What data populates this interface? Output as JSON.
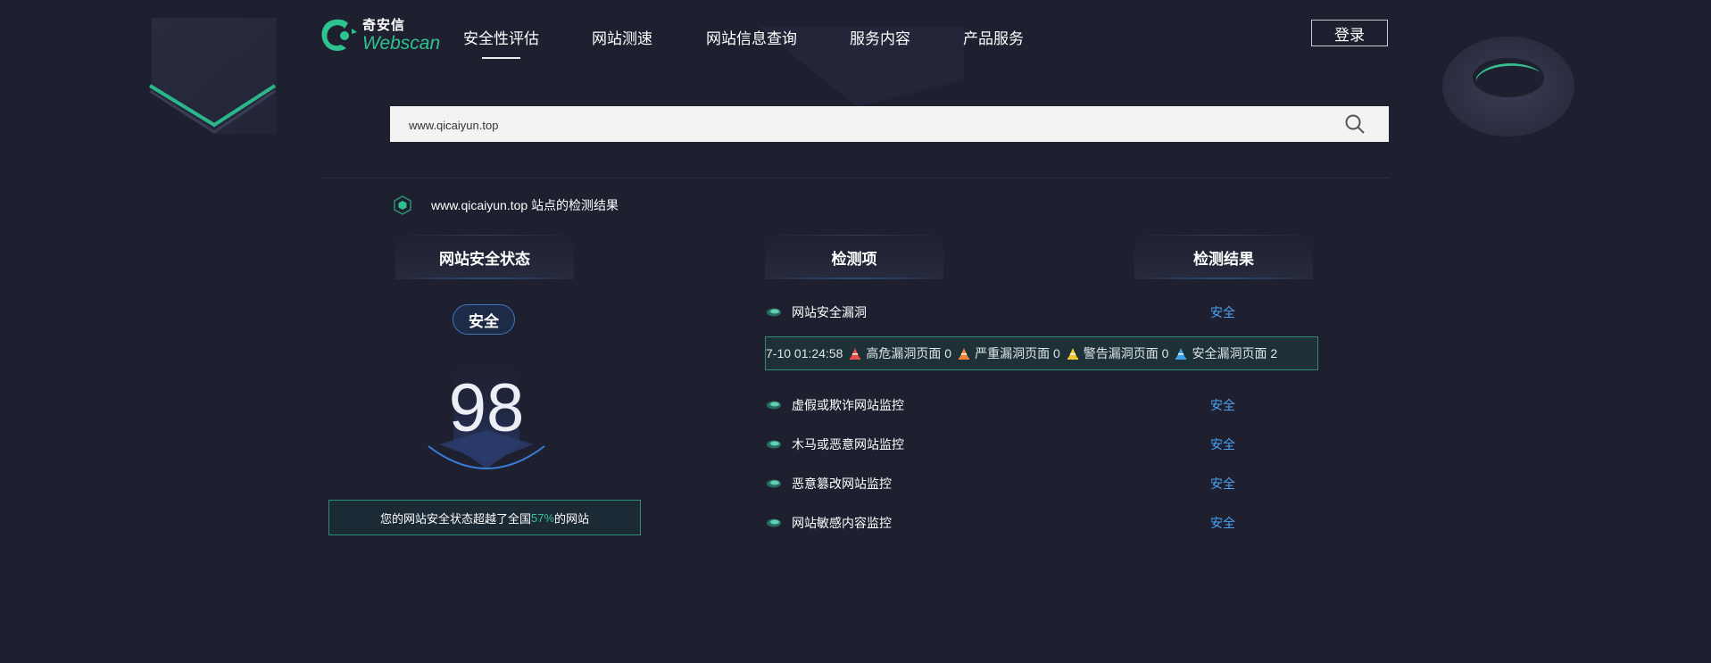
{
  "brand": {
    "name_cn": "奇安信",
    "name_en": "Webscan"
  },
  "nav": [
    {
      "label": "安全性评估",
      "active": true
    },
    {
      "label": "网站测速",
      "active": false
    },
    {
      "label": "网站信息查询",
      "active": false
    },
    {
      "label": "服务内容",
      "active": false
    },
    {
      "label": "产品服务",
      "active": false
    }
  ],
  "login_label": "登录",
  "search": {
    "value": "www.qicaiyun.top"
  },
  "result_title": "www.qicaiyun.top 站点的检测结果",
  "columns": {
    "status": "网站安全状态",
    "items": "检测项",
    "results": "检测结果"
  },
  "status": {
    "badge": "安全",
    "score": "98",
    "rank_prefix": "您的网站安全状态超越了全国 ",
    "rank_pct": "57%",
    "rank_suffix": "的网站"
  },
  "ticker": {
    "time": "7-10 01:24:58",
    "items": [
      {
        "label": "高危漏洞页面",
        "count": "0",
        "color": "#e5504a"
      },
      {
        "label": "严重漏洞页面",
        "count": "0",
        "color": "#f0823c"
      },
      {
        "label": "警告漏洞页面",
        "count": "0",
        "color": "#f2c531"
      },
      {
        "label": "安全漏洞页面",
        "count": "2",
        "color": "#3fa3e8"
      }
    ]
  },
  "checks": [
    {
      "name": "网站安全漏洞",
      "result": "安全"
    },
    {
      "name": "虚假或欺诈网站监控",
      "result": "安全"
    },
    {
      "name": "木马或恶意网站监控",
      "result": "安全"
    },
    {
      "name": "恶意篡改网站监控",
      "result": "安全"
    },
    {
      "name": "网站敏感内容监控",
      "result": "安全"
    }
  ],
  "colors": {
    "accent_green": "#2ec28d",
    "link_blue": "#4aa3f5",
    "background": "#1e2030"
  },
  "icons": [
    "logo-mark-icon",
    "search-icon",
    "hexagon-icon",
    "shield-leaf-icon",
    "warning-cone-icon"
  ]
}
